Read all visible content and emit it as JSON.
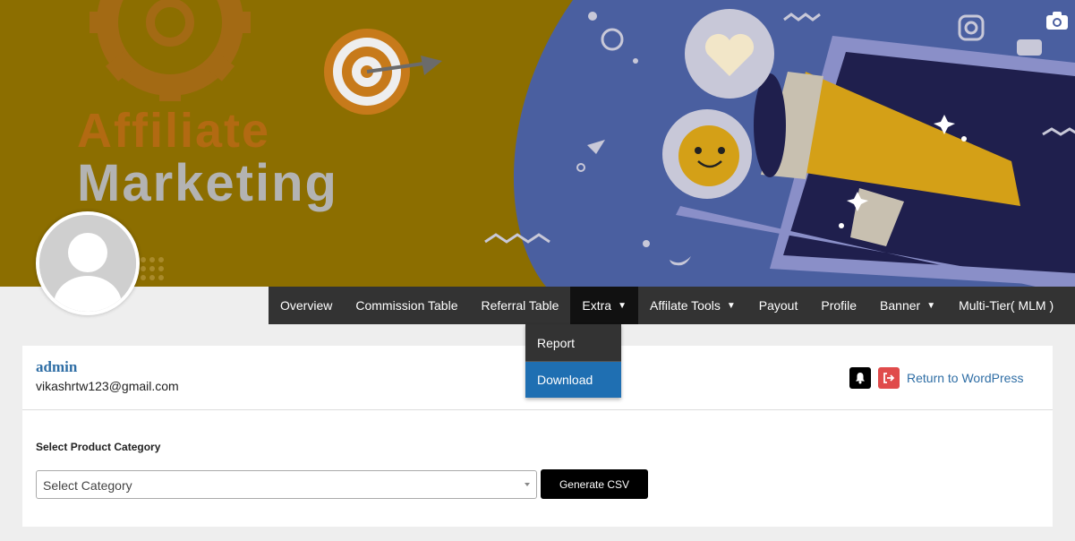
{
  "banner": {
    "title_line1": "Affiliate",
    "title_line2": "Marketing",
    "camera_icon": "camera-icon"
  },
  "navbar": {
    "items": [
      {
        "label": "Overview"
      },
      {
        "label": "Commission Table"
      },
      {
        "label": "Referral Table"
      },
      {
        "label": "Extra",
        "caret": "▼"
      },
      {
        "label": "Affilate Tools",
        "caret": "▼"
      },
      {
        "label": "Payout"
      },
      {
        "label": "Profile"
      },
      {
        "label": "Banner",
        "caret": "▼"
      },
      {
        "label": "Multi-Tier( MLM )"
      }
    ],
    "active": "Extra"
  },
  "dropdown": {
    "items": [
      {
        "label": "Report"
      },
      {
        "label": "Download"
      }
    ]
  },
  "user": {
    "name": "admin",
    "email": "vikashrtw123@gmail.com"
  },
  "header_actions": {
    "return_label": "Return to WordPress"
  },
  "form": {
    "category_label": "Select Product Category",
    "category_placeholder": "Select Category",
    "generate_label": "Generate CSV"
  },
  "colors": {
    "banner_gold": "#8c6e00",
    "banner_blue": "#4a5fa0",
    "navbar_bg": "#333333",
    "dropdown_highlight": "#1f6fb2",
    "link_blue": "#2f6ea5",
    "logout_red": "#e04b4b"
  }
}
